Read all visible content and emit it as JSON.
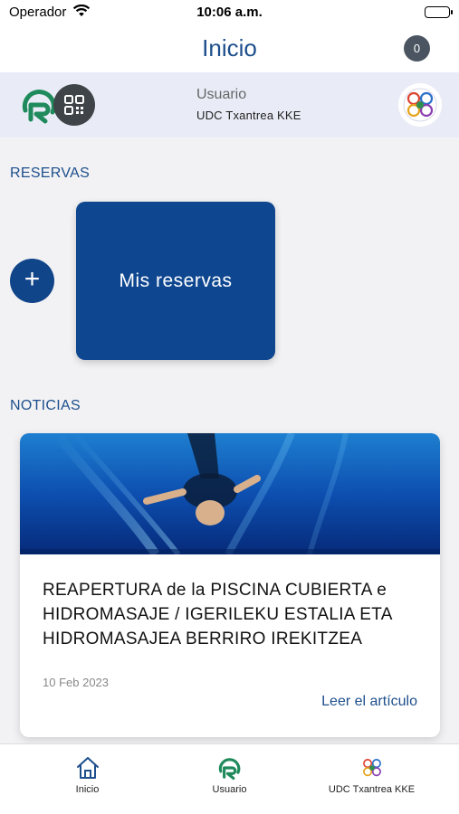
{
  "status_bar": {
    "carrier": "Operador",
    "time": "10:06 a.m."
  },
  "header": {
    "title": "Inicio",
    "notification_count": "0"
  },
  "user": {
    "label": "Usuario",
    "club": "UDC Txantrea KKE"
  },
  "reservas": {
    "section_title": "RESERVAS",
    "add_label": "+",
    "card_label": "Mis reservas"
  },
  "noticias": {
    "section_title": "NOTICIAS",
    "items": [
      {
        "title": "REAPERTURA de la PISCINA CUBIERTA e HIDROMASAJE / IGERILEKU ESTALIA ETA HIDROMASAJEA BERRIRO IREKITZEA",
        "date": "10 Feb 2023",
        "link_label": "Leer el artículo"
      }
    ]
  },
  "tabbar": {
    "tabs": [
      {
        "label": "Inicio",
        "icon": "home-icon"
      },
      {
        "label": "Usuario",
        "icon": "app-logo-icon"
      },
      {
        "label": "UDC Txantrea KKE",
        "icon": "club-logo-icon"
      }
    ]
  },
  "colors": {
    "primary": "#0e4690",
    "accent_text": "#1d4f8c",
    "logo_green": "#1f8a5b"
  }
}
